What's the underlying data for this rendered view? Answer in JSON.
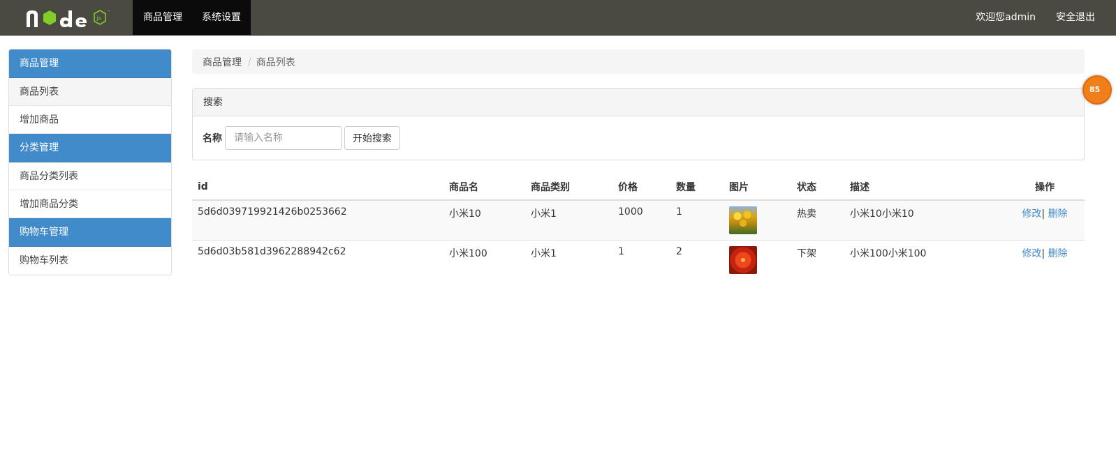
{
  "brand": {
    "logo_text": "node js"
  },
  "topnav": {
    "items": [
      {
        "label": "商品管理"
      },
      {
        "label": "系统设置"
      }
    ],
    "welcome": "欢迎您admin",
    "logout": "安全退出"
  },
  "sidebar": {
    "groups": [
      {
        "title": "商品管理",
        "items": [
          {
            "label": "商品列表"
          },
          {
            "label": "增加商品"
          }
        ]
      },
      {
        "title": "分类管理",
        "items": [
          {
            "label": "商品分类列表"
          },
          {
            "label": "增加商品分类"
          }
        ]
      },
      {
        "title": "购物车管理",
        "items": [
          {
            "label": "购物车列表"
          }
        ]
      }
    ]
  },
  "breadcrumb": {
    "items": [
      "商品管理",
      "商品列表"
    ],
    "separator": "/"
  },
  "search": {
    "title": "搜索",
    "name_label": "名称",
    "name_placeholder": "请输入名称",
    "name_value": "",
    "button": "开始搜索"
  },
  "table": {
    "headers": [
      "id",
      "商品名",
      "商品类别",
      "价格",
      "数量",
      "图片",
      "状态",
      "描述",
      "操作"
    ],
    "rows": [
      {
        "id": "5d6d039719921426b0253662",
        "name": "小米10",
        "category": "小米1",
        "price": "1000",
        "qty": "1",
        "image": "yellow-tulips-thumbnail",
        "status": "热卖",
        "desc": "小米10小米10",
        "edit": "修改",
        "sep": "|",
        "delete": "删除"
      },
      {
        "id": "5d6d03b581d3962288942c62",
        "name": "小米100",
        "category": "小米1",
        "price": "1",
        "qty": "2",
        "image": "red-flower-thumbnail",
        "status": "下架",
        "desc": "小米100小米100",
        "edit": "修改",
        "sep": "|",
        "delete": "删除"
      }
    ]
  },
  "badge": {
    "text": "85"
  },
  "colors": {
    "navbar": "#4a4a41",
    "nav_active": "#0b0b0b",
    "accent": "#428bca",
    "node_green": "#83cd29"
  }
}
